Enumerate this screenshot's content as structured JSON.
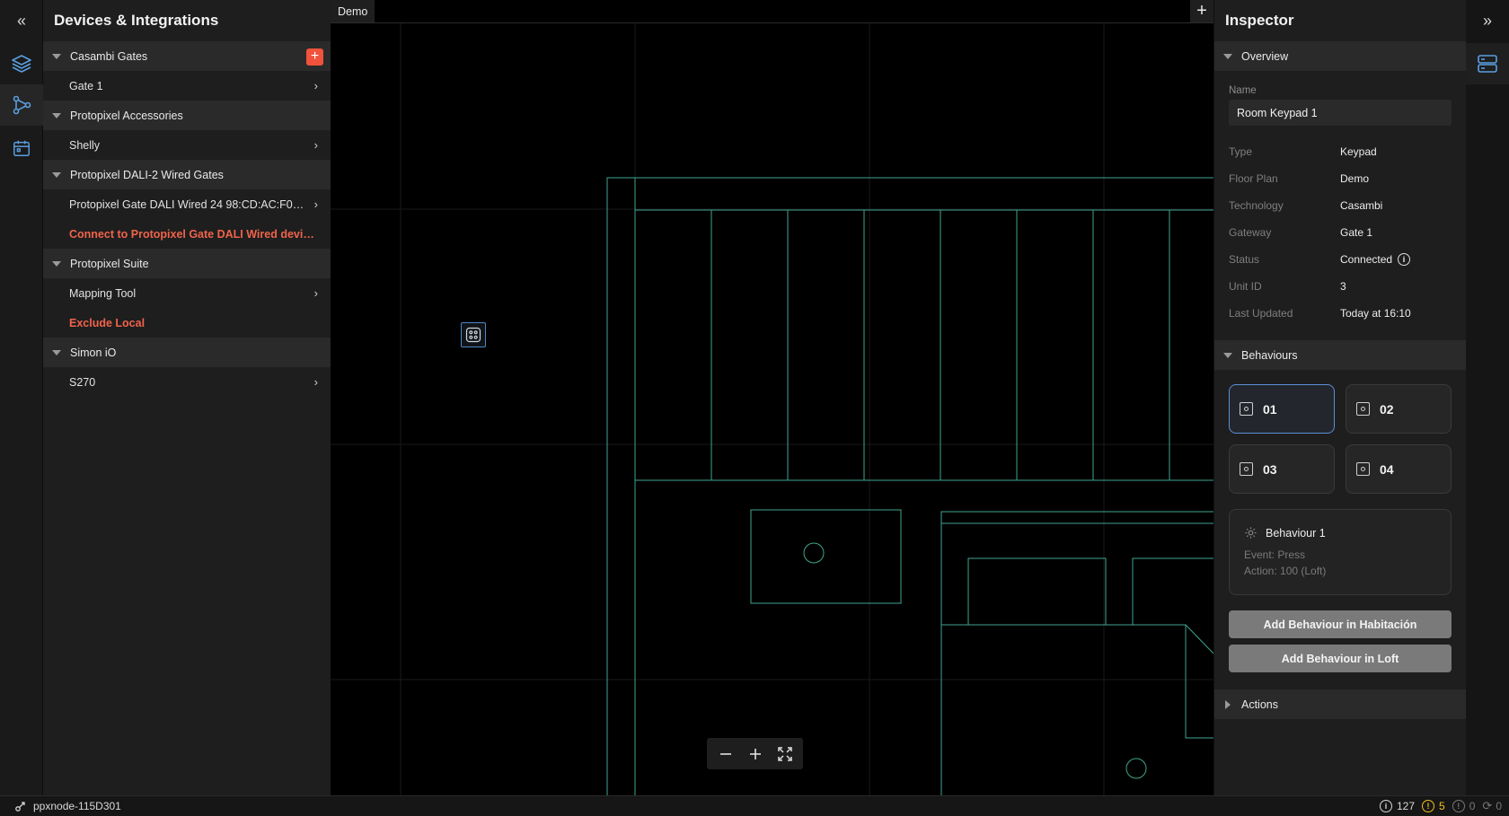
{
  "rail": {
    "collapse_glyph": "«",
    "icons": [
      "layers-icon",
      "integrations-icon",
      "calendar-icon"
    ]
  },
  "devices_panel": {
    "title": "Devices & Integrations",
    "groups": [
      {
        "label": "Casambi Gates",
        "items": [
          {
            "label": "Gate 1",
            "chevron": true
          }
        ]
      },
      {
        "label": "Protopixel Accessories",
        "items": [
          {
            "label": "Shelly",
            "chevron": true
          }
        ]
      },
      {
        "label": "Protopixel DALI-2 Wired Gates",
        "items": [
          {
            "label": "Protopixel Gate DALI Wired 24 98:CD:AC:F0:8...",
            "chevron": true
          },
          {
            "label": "Connect to Protopixel Gate DALI Wired devices",
            "link": true
          }
        ]
      },
      {
        "label": "Protopixel Suite",
        "items": [
          {
            "label": "Mapping Tool",
            "chevron": true
          },
          {
            "label": "Exclude Local",
            "link": true
          }
        ]
      },
      {
        "label": "Simon iO",
        "items": [
          {
            "label": "S270",
            "chevron": true
          }
        ]
      }
    ]
  },
  "canvas": {
    "tab_label": "Demo",
    "add_tab_glyph": "+",
    "zoom": {
      "out": "−",
      "in": "+",
      "fit": "⤢"
    }
  },
  "inspector": {
    "title": "Inspector",
    "overview_label": "Overview",
    "name_label": "Name",
    "name_value": "Room Keypad 1",
    "properties": [
      {
        "key": "Type",
        "value": "Keypad"
      },
      {
        "key": "Floor Plan",
        "value": "Demo"
      },
      {
        "key": "Technology",
        "value": "Casambi"
      },
      {
        "key": "Gateway",
        "value": "Gate 1"
      },
      {
        "key": "Status",
        "value": "Connected"
      },
      {
        "key": "Unit ID",
        "value": "3"
      },
      {
        "key": "Last Updated",
        "value": "Today at 16:10"
      }
    ],
    "behaviours_label": "Behaviours",
    "behaviour_buttons": [
      "01",
      "02",
      "03",
      "04"
    ],
    "selected_button": "01",
    "behaviour_card": {
      "title": "Behaviour 1",
      "event": "Event: Press",
      "action": "Action: 100 (Loft)"
    },
    "add_buttons": [
      "Add Behaviour in Habitación",
      "Add Behaviour in Loft"
    ],
    "actions_label": "Actions"
  },
  "right_rail": {
    "collapse_glyph": "»",
    "icons": [
      "server-icon"
    ]
  },
  "status_bar": {
    "node": "ppxnode-115D301",
    "info_count": "127",
    "warning_count": "5",
    "error_count": "0",
    "sync_count": "0"
  },
  "colors": {
    "accent_orange": "#f0523c",
    "link_orange": "#f0634b",
    "selection_blue": "#5b8fd6",
    "plan_lines": "#3fa58f",
    "warning": "#f0c020"
  }
}
